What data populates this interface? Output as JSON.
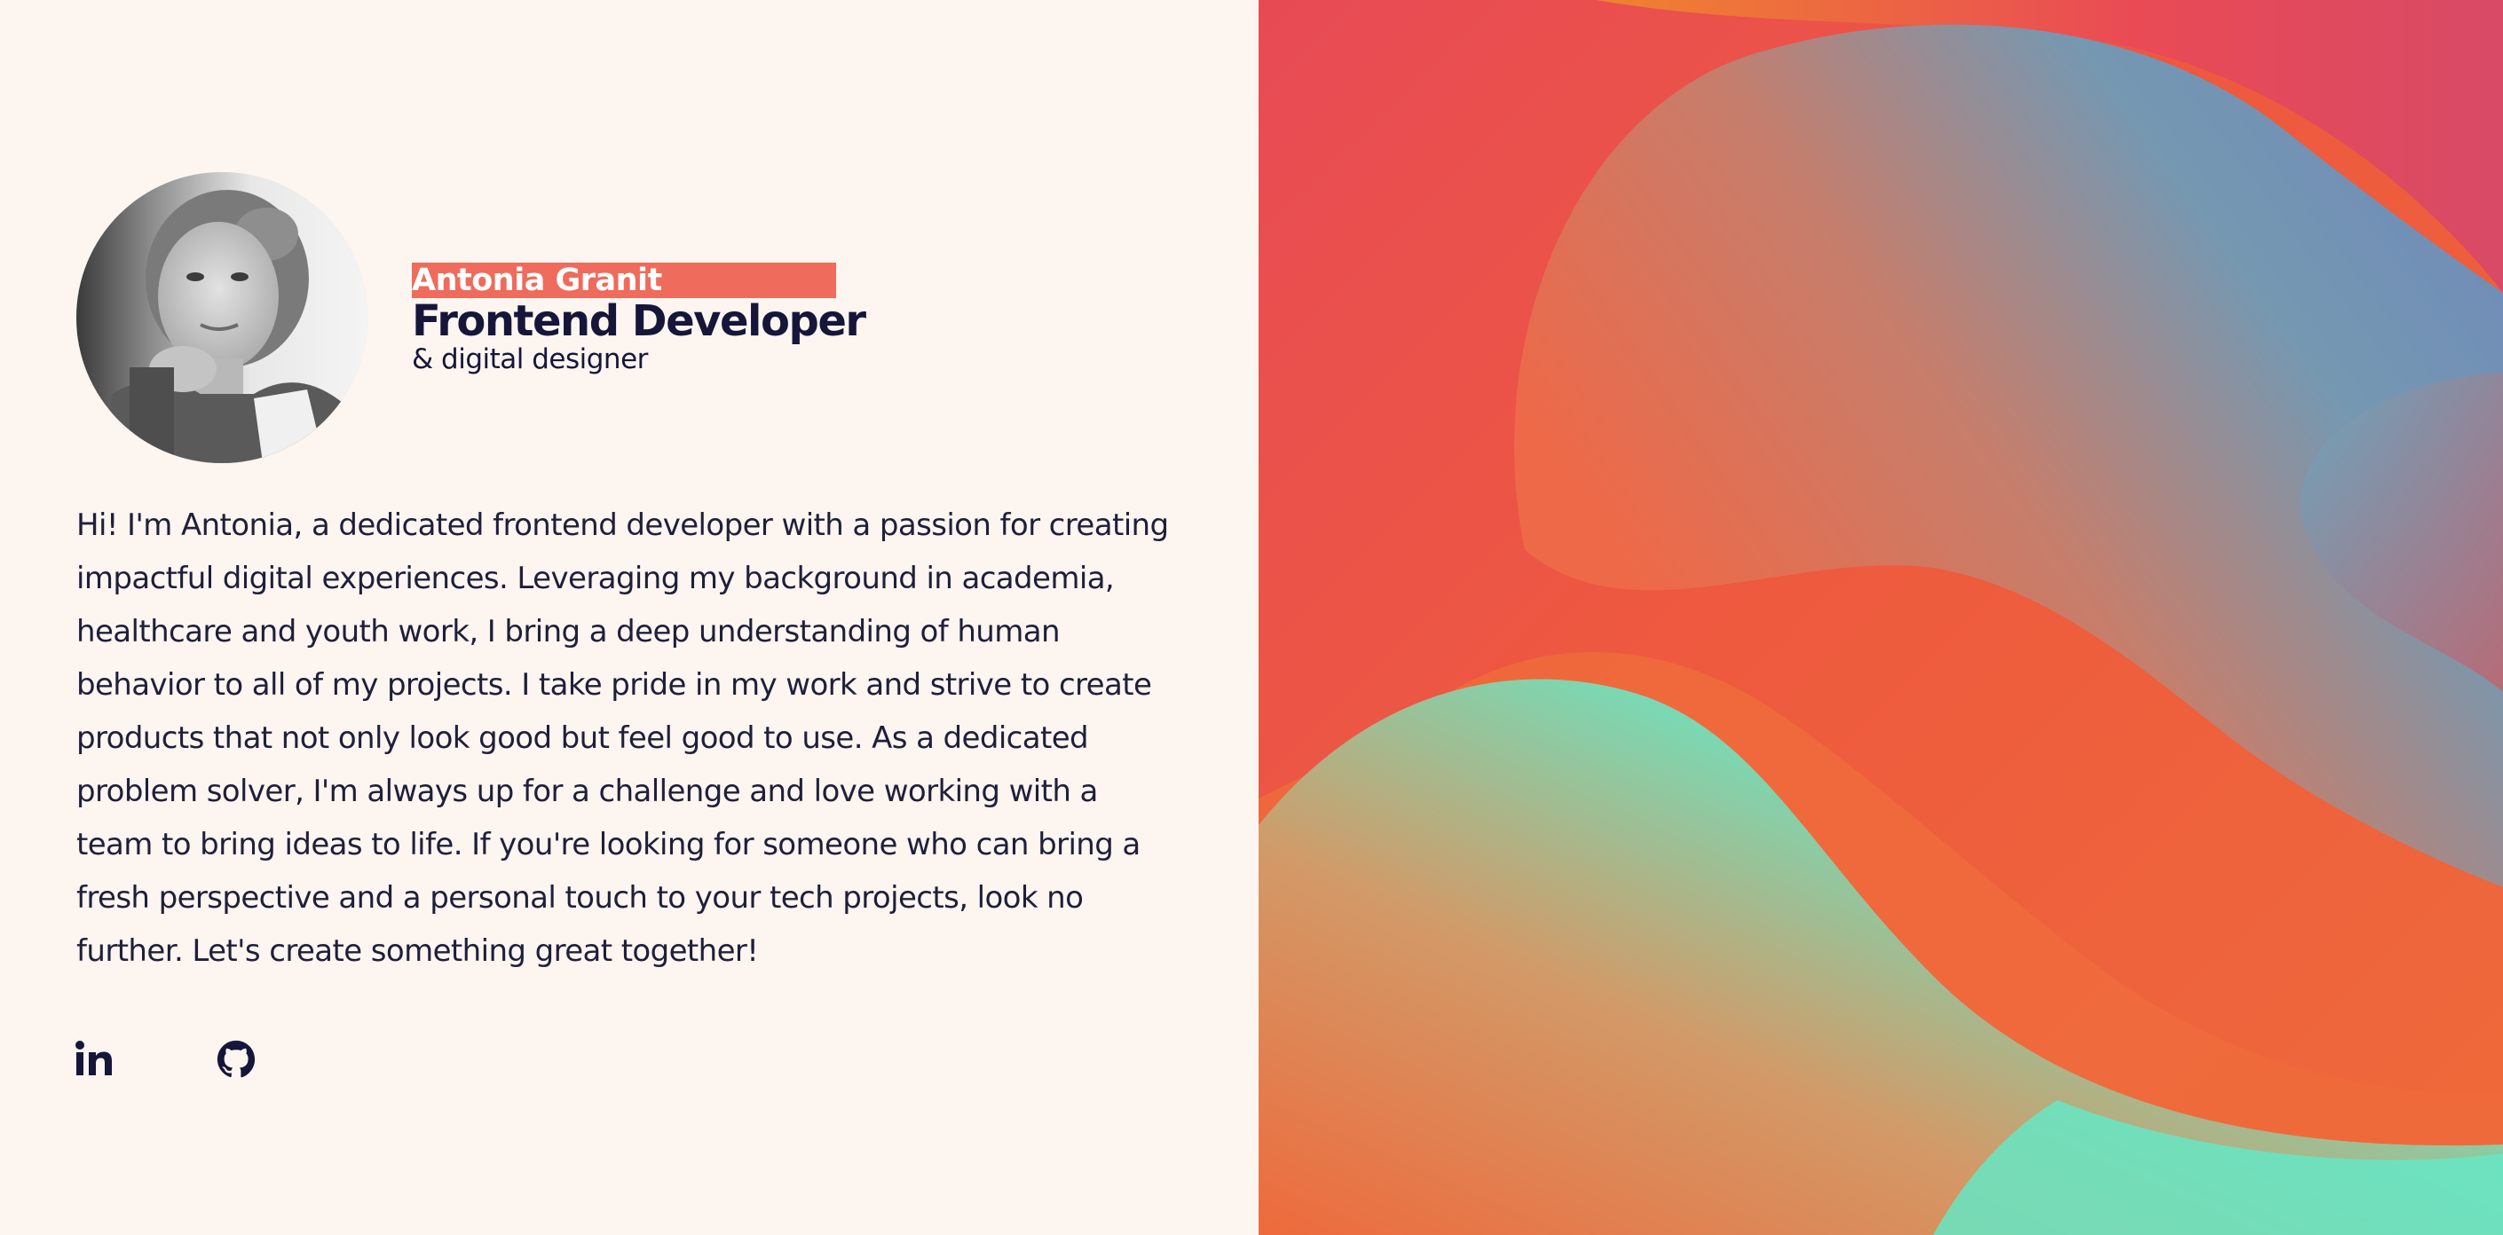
{
  "profile": {
    "name": "Antonia Granit",
    "role": "Frontend Developer",
    "subrole": "& digital designer",
    "avatar_alt": "Portrait of Antonia Granit"
  },
  "bio": "Hi! I'm Antonia, a dedicated frontend developer with a passion for creating impactful digital experiences. Leveraging my background in academia, healthcare and youth work, I bring a deep understanding of human behavior to all of my projects. I take pride in my work and strive to create products that not only look good but feel good to use. As a dedicated problem solver, I'm always up for a challenge and love working with a team to bring ideas to life. If you're looking for someone who can bring a fresh perspective and a personal touch to your tech projects, look no further. Let's create something great together!",
  "socials": [
    {
      "icon": "linkedin-icon",
      "label": "LinkedIn"
    },
    {
      "icon": "github-icon",
      "label": "GitHub"
    }
  ],
  "colors": {
    "background": "#fcf5f0",
    "accent": "#ef6b5b",
    "text_dark": "#16163a",
    "art_orange": "#ee5c3c",
    "art_teal": "#66e6c4",
    "art_blue": "#6a93b8",
    "art_pink": "#e64a5b"
  }
}
